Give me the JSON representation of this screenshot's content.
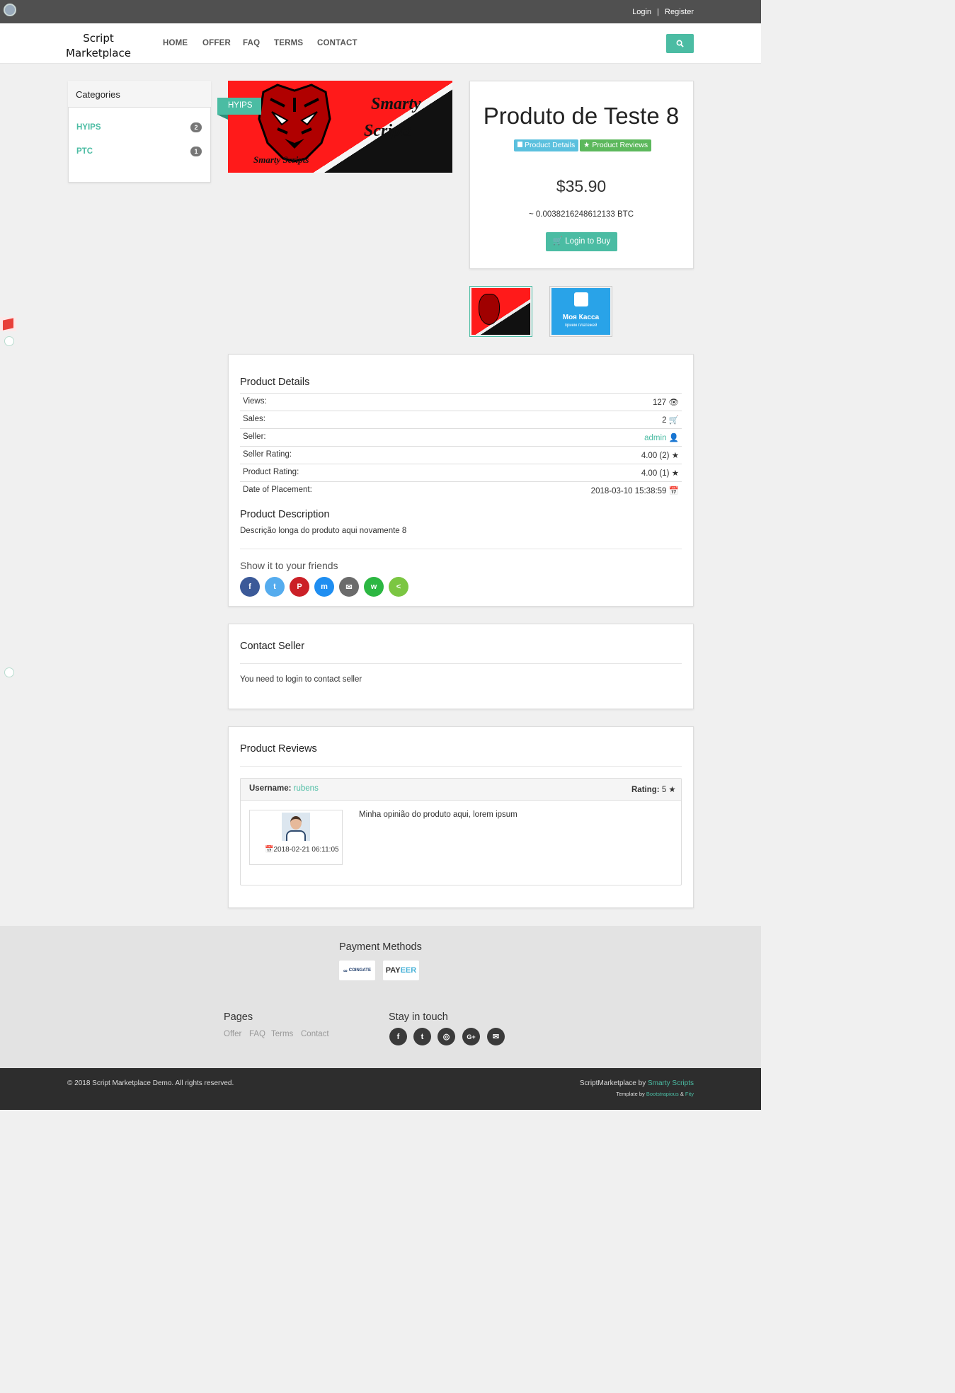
{
  "topbar": {
    "login": "Login",
    "separator": "|",
    "register": "Register"
  },
  "brand": {
    "line1": "Script",
    "line2": "Marketplace"
  },
  "nav": {
    "items": [
      "HOME",
      "OFFER",
      "FAQ",
      "TERMS",
      "CONTACT"
    ]
  },
  "sidebar": {
    "title": "Categories",
    "categories": [
      {
        "label": "HYIPS",
        "count": "2"
      },
      {
        "label": "PTC",
        "count": "1"
      }
    ]
  },
  "banner": {
    "ribbon": "HYIPS",
    "text_line1": "Smarty",
    "text_line2": "Scripts",
    "text_small": "Smarty Scripts"
  },
  "product": {
    "title": "Produto de Teste 8",
    "tab_details": "Product Details",
    "tab_reviews": "Product Reviews",
    "price": "$35.90",
    "btc": "~ 0.0038216248612133 BTC",
    "buy_label": "Login to Buy"
  },
  "thumbs": {
    "second_line1": "Моя Касса",
    "second_line2": "прием платежей"
  },
  "details": {
    "title": "Product Details",
    "rows": [
      {
        "label": "Views:",
        "value": "127"
      },
      {
        "label": "Sales:",
        "value": "2"
      },
      {
        "label": "Seller:",
        "value": "admin"
      },
      {
        "label": "Seller Rating:",
        "value": "4.00 (2)"
      },
      {
        "label": "Product Rating:",
        "value": "4.00 (1)"
      },
      {
        "label": "Date of Placement:",
        "value": "2018-03-10 15:38:59"
      }
    ],
    "description_title": "Product Description",
    "description": "Descrição longa do produto aqui novamente 8",
    "share_title": "Show it to your friends"
  },
  "contact": {
    "title": "Contact Seller",
    "text": "You need to login to contact seller"
  },
  "reviews": {
    "title": "Product Reviews",
    "username_label": "Username:",
    "username": "rubens",
    "rating_label": "Rating:",
    "rating": "5",
    "date": "2018-02-21 06:11:05",
    "text": "Minha opinião do produto aqui, lorem ipsum"
  },
  "footer": {
    "payment_title": "Payment Methods",
    "coingate": "COINGATE",
    "payeer_a": "PAY",
    "payeer_b": "EER",
    "pages_title": "Pages",
    "pages": [
      "Offer",
      "FAQ",
      "Terms",
      "Contact"
    ],
    "stay_title": "Stay in touch",
    "copyright": "© 2018 Script Marketplace Demo. All rights reserved.",
    "credit_prefix": "ScriptMarketplace by ",
    "credit_link": "Smarty Scripts",
    "template_prefix": "Template by ",
    "template_link1": "Bootstrapious",
    "template_amp": " & ",
    "template_link2": "Fity"
  },
  "colors": {
    "accent": "#4bbca3",
    "info": "#5bc0de",
    "success": "#5cb85c",
    "topbar": "#505050",
    "footer_dark": "#2d2d2d"
  }
}
